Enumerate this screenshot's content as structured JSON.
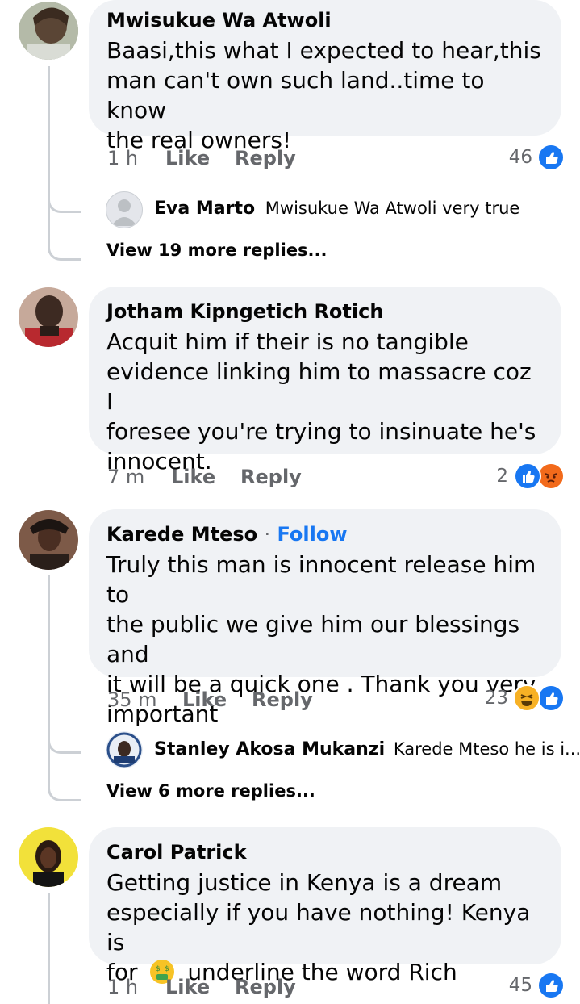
{
  "comments": [
    {
      "author": "Mwisukue Wa Atwoli",
      "text_lines": [
        "Baasi,this what I expected to hear,this",
        "man can't own such land..time to know",
        "the real owners!"
      ],
      "time": "1 h",
      "like_label": "Like",
      "reply_label": "Reply",
      "reaction_count": "46",
      "reply": {
        "author": "Eva Marto",
        "text": "Mwisukue Wa Atwoli very true"
      },
      "view_more": "View 19 more replies..."
    },
    {
      "author": "Jotham Kipngetich Rotich",
      "text_lines": [
        "Acquit him if their is no tangible",
        "evidence linking him to massacre coz I",
        "foresee you're trying to insinuate he's",
        "innocent."
      ],
      "time": "7 m",
      "like_label": "Like",
      "reply_label": "Reply",
      "reaction_count": "2"
    },
    {
      "author": "Karede Mteso",
      "separator": "·",
      "follow_label": "Follow",
      "text_lines": [
        "Truly this man is innocent release him to",
        "the public we give him our blessings and",
        "it will be a quick one . Thank you very",
        "important"
      ],
      "time": "35 m",
      "like_label": "Like",
      "reply_label": "Reply",
      "reaction_count": "23",
      "reply": {
        "author": "Stanley Akosa Mukanzi",
        "text": "Karede Mteso he is i..."
      },
      "view_more": "View 6 more replies..."
    },
    {
      "author": "Carol Patrick",
      "text_lines": [
        "Getting justice in Kenya is a dream",
        "especially if you have nothing! Kenya is",
        "underline the word Rich"
      ],
      "text_prefix": "for",
      "time": "1 h",
      "like_label": "Like",
      "reply_label": "Reply",
      "reaction_count": "45"
    }
  ],
  "colors": {
    "link": "#1877f2",
    "bubble": "#f0f2f5",
    "meta": "#65676b",
    "thread": "#ccd0d5"
  }
}
